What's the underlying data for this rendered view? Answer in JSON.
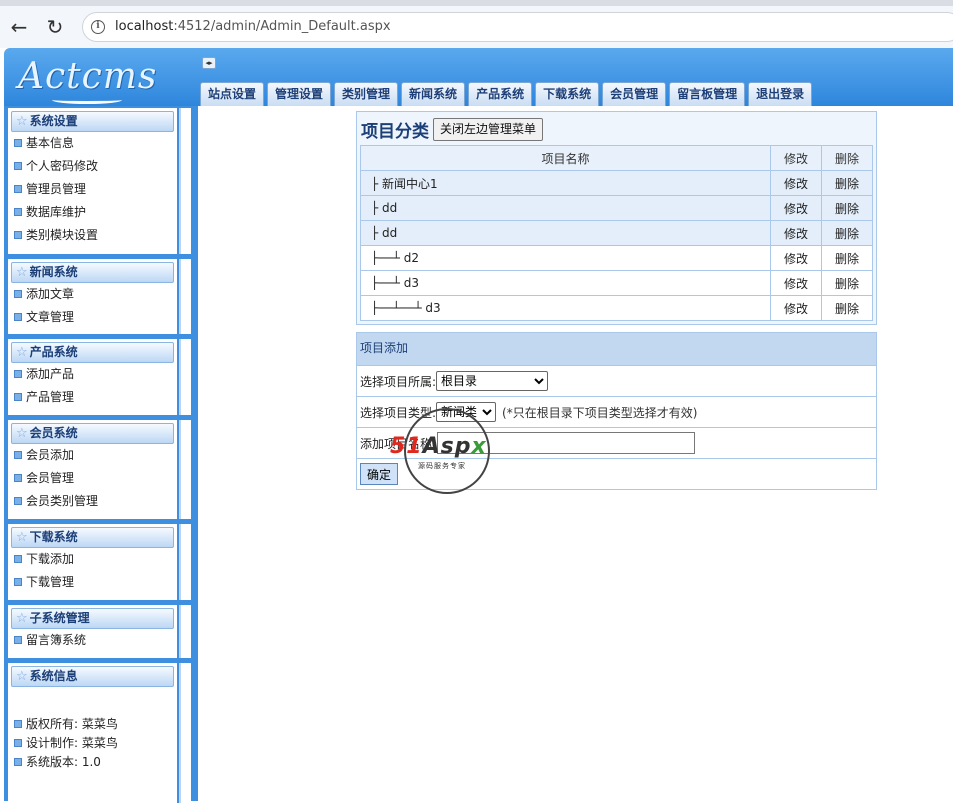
{
  "browser": {
    "url_host": "localhost",
    "url_rest": ":4512/admin/Admin_Default.aspx",
    "back_icon": "back-arrow-icon",
    "reload_icon": "reload-icon"
  },
  "header": {
    "logo_text": "Actcms",
    "toggle_label": "◂▸",
    "tabs": [
      "站点设置",
      "管理设置",
      "类别管理",
      "新闻系统",
      "产品系统",
      "下载系统",
      "会员管理",
      "留言板管理",
      "退出登录"
    ]
  },
  "sidebar": {
    "panels": [
      {
        "title": "系统设置",
        "items": [
          "基本信息",
          "个人密码修改",
          "管理员管理",
          "数据库维护",
          "类别模块设置"
        ]
      },
      {
        "title": "新闻系统",
        "items": [
          "添加文章",
          "文章管理"
        ]
      },
      {
        "title": "产品系统",
        "items": [
          "添加产品",
          "产品管理"
        ]
      },
      {
        "title": "会员系统",
        "items": [
          "会员添加",
          "会员管理",
          "会员类别管理"
        ]
      },
      {
        "title": "下载系统",
        "items": [
          "下载添加",
          "下载管理"
        ]
      },
      {
        "title": "子系统管理",
        "items": [
          "留言簿系统"
        ]
      },
      {
        "title": "系统信息",
        "items": [
          "版权所有: 菜菜鸟",
          "设计制作: 菜菜鸟",
          "系统版本: 1.0"
        ]
      }
    ]
  },
  "main": {
    "title": "项目分类",
    "close_button": "关闭左边管理菜单",
    "table": {
      "headers": [
        "项目名称",
        "修改",
        "删除"
      ],
      "rows": [
        {
          "name": "├ 新闻中心1",
          "edit": "修改",
          "delete": "删除"
        },
        {
          "name": "├ dd",
          "edit": "修改",
          "delete": "删除"
        },
        {
          "name": "├ dd",
          "edit": "修改",
          "delete": "删除"
        },
        {
          "name": "├──┴ d2",
          "edit": "修改",
          "delete": "删除"
        },
        {
          "name": "├──┴ d3",
          "edit": "修改",
          "delete": "删除"
        },
        {
          "name": "├──┴──┴ d3",
          "edit": "修改",
          "delete": "删除"
        }
      ]
    },
    "add_form": {
      "title": "项目添加",
      "parent_label": "选择项目所属:",
      "parent_value": "根目录",
      "type_label": "选择项目类型:",
      "type_value": "新闻类",
      "type_hint": "(*只在根目录下项目类型选择才有效)",
      "name_label": "添加项目名称:",
      "name_value": "",
      "submit_label": "确定"
    }
  },
  "watermark": {
    "brand_red": "51",
    "brand_dark": "Asp",
    "brand_green": "x",
    "tagline": "源码服务专家"
  }
}
